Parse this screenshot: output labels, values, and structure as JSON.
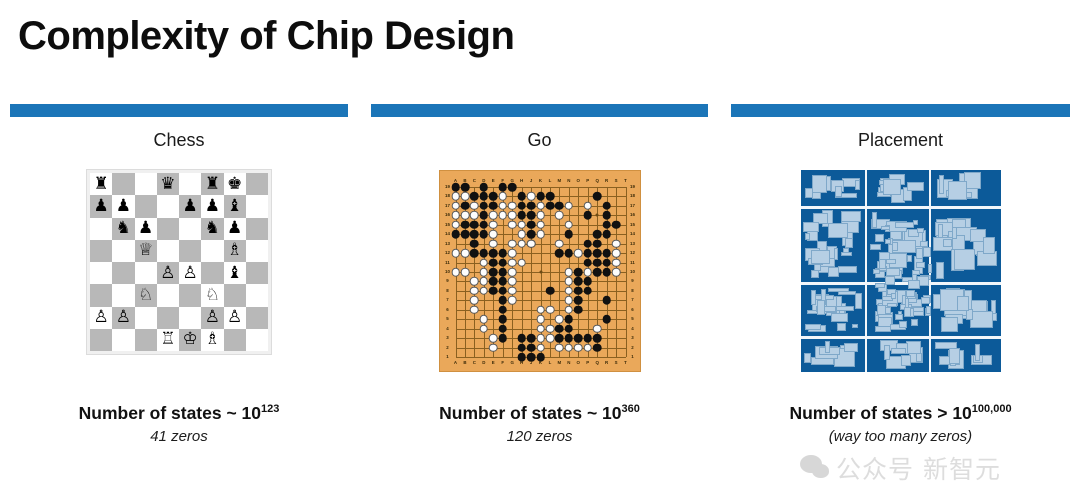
{
  "slide": {
    "title": "Complexity of Chip Design",
    "accent_color": "#1b75b8",
    "background_color": "#ffffff"
  },
  "columns": [
    {
      "id": "chess",
      "heading": "Chess",
      "figure": "chess-board",
      "caption_main_prefix": "Number of states ~ 10",
      "caption_main_exponent": "123",
      "caption_sub": "41 zeros"
    },
    {
      "id": "go",
      "heading": "Go",
      "figure": "go-board",
      "caption_main_prefix": "Number of states ~ 10",
      "caption_main_exponent": "360",
      "caption_sub": "120 zeros"
    },
    {
      "id": "placement",
      "heading": "Placement",
      "figure": "chip-placement",
      "caption_main_prefix": "Number of states > 10",
      "caption_main_exponent": "100,000",
      "caption_sub": "(way too many zeros)"
    }
  ],
  "chess": {
    "light_square_color": "#ffffff",
    "dark_square_color": "#b8b8b8",
    "ranks": [
      [
        "r",
        "",
        "",
        "q",
        "",
        "r",
        "k",
        ""
      ],
      [
        "p",
        "p",
        "",
        "",
        "p",
        "p",
        "b",
        ""
      ],
      [
        "",
        "n",
        "p",
        "",
        "",
        "n",
        "p",
        ""
      ],
      [
        "",
        "",
        "Q",
        "",
        "",
        "",
        "B",
        ""
      ],
      [
        "",
        "",
        "",
        "P",
        "P",
        "",
        "b",
        ""
      ],
      [
        "",
        "",
        "N",
        "",
        "",
        "N",
        "",
        ""
      ],
      [
        "P",
        "P",
        "",
        "",
        "",
        "P",
        "P",
        ""
      ],
      [
        "",
        "",
        "",
        "R",
        "K",
        "B",
        "",
        ""
      ]
    ],
    "glyphs": {
      "r": "♜",
      "n": "♞",
      "b": "♝",
      "q": "♛",
      "k": "♚",
      "p": "♟",
      "R": "♖",
      "N": "♘",
      "B": "♗",
      "Q": "♕",
      "K": "♔",
      "P": "♙"
    }
  },
  "go": {
    "size": 19,
    "board_color": "#eaa85a",
    "line_color": "#8a6020",
    "black_color": "#111111",
    "white_color": "#fdfdfd",
    "column_labels": [
      "A",
      "B",
      "C",
      "D",
      "E",
      "F",
      "G",
      "H",
      "J",
      "K",
      "L",
      "M",
      "N",
      "O",
      "P",
      "Q",
      "R",
      "S",
      "T"
    ],
    "row_labels": [
      "19",
      "18",
      "17",
      "16",
      "15",
      "14",
      "13",
      "12",
      "11",
      "10",
      "9",
      "8",
      "7",
      "6",
      "5",
      "4",
      "3",
      "2",
      "1"
    ],
    "black_stones": [
      [
        1,
        19
      ],
      [
        2,
        19
      ],
      [
        4,
        19
      ],
      [
        6,
        19
      ],
      [
        7,
        19
      ],
      [
        3,
        18
      ],
      [
        4,
        18
      ],
      [
        5,
        18
      ],
      [
        8,
        18
      ],
      [
        10,
        18
      ],
      [
        11,
        18
      ],
      [
        16,
        18
      ],
      [
        2,
        17
      ],
      [
        4,
        17
      ],
      [
        5,
        17
      ],
      [
        8,
        17
      ],
      [
        9,
        17
      ],
      [
        11,
        17
      ],
      [
        12,
        17
      ],
      [
        17,
        17
      ],
      [
        4,
        16
      ],
      [
        8,
        16
      ],
      [
        9,
        16
      ],
      [
        15,
        16
      ],
      [
        17,
        16
      ],
      [
        2,
        15
      ],
      [
        3,
        15
      ],
      [
        4,
        15
      ],
      [
        9,
        15
      ],
      [
        17,
        15
      ],
      [
        18,
        15
      ],
      [
        1,
        14
      ],
      [
        2,
        14
      ],
      [
        3,
        14
      ],
      [
        4,
        14
      ],
      [
        9,
        14
      ],
      [
        13,
        14
      ],
      [
        16,
        14
      ],
      [
        17,
        14
      ],
      [
        3,
        13
      ],
      [
        9,
        13
      ],
      [
        15,
        13
      ],
      [
        16,
        13
      ],
      [
        3,
        12
      ],
      [
        4,
        12
      ],
      [
        5,
        12
      ],
      [
        6,
        12
      ],
      [
        12,
        12
      ],
      [
        13,
        12
      ],
      [
        15,
        12
      ],
      [
        16,
        12
      ],
      [
        17,
        12
      ],
      [
        5,
        11
      ],
      [
        6,
        11
      ],
      [
        15,
        11
      ],
      [
        16,
        11
      ],
      [
        17,
        11
      ],
      [
        5,
        10
      ],
      [
        6,
        10
      ],
      [
        14,
        10
      ],
      [
        16,
        10
      ],
      [
        17,
        10
      ],
      [
        5,
        9
      ],
      [
        6,
        9
      ],
      [
        14,
        9
      ],
      [
        15,
        9
      ],
      [
        5,
        8
      ],
      [
        6,
        8
      ],
      [
        11,
        8
      ],
      [
        14,
        8
      ],
      [
        15,
        8
      ],
      [
        6,
        7
      ],
      [
        14,
        7
      ],
      [
        17,
        7
      ],
      [
        6,
        6
      ],
      [
        14,
        6
      ],
      [
        6,
        5
      ],
      [
        13,
        5
      ],
      [
        17,
        5
      ],
      [
        6,
        4
      ],
      [
        12,
        4
      ],
      [
        13,
        4
      ],
      [
        6,
        3
      ],
      [
        8,
        3
      ],
      [
        9,
        3
      ],
      [
        12,
        3
      ],
      [
        13,
        3
      ],
      [
        14,
        3
      ],
      [
        15,
        3
      ],
      [
        16,
        3
      ],
      [
        8,
        2
      ],
      [
        9,
        2
      ],
      [
        16,
        2
      ],
      [
        8,
        1
      ],
      [
        9,
        1
      ],
      [
        10,
        1
      ]
    ],
    "white_stones": [
      [
        1,
        18
      ],
      [
        2,
        18
      ],
      [
        6,
        18
      ],
      [
        9,
        18
      ],
      [
        1,
        17
      ],
      [
        3,
        17
      ],
      [
        6,
        17
      ],
      [
        7,
        17
      ],
      [
        10,
        17
      ],
      [
        13,
        17
      ],
      [
        15,
        17
      ],
      [
        1,
        16
      ],
      [
        2,
        16
      ],
      [
        3,
        16
      ],
      [
        5,
        16
      ],
      [
        6,
        16
      ],
      [
        7,
        16
      ],
      [
        10,
        16
      ],
      [
        12,
        16
      ],
      [
        1,
        15
      ],
      [
        5,
        15
      ],
      [
        7,
        15
      ],
      [
        8,
        15
      ],
      [
        10,
        15
      ],
      [
        13,
        15
      ],
      [
        5,
        14
      ],
      [
        8,
        14
      ],
      [
        10,
        14
      ],
      [
        5,
        13
      ],
      [
        7,
        13
      ],
      [
        8,
        13
      ],
      [
        9,
        13
      ],
      [
        12,
        13
      ],
      [
        18,
        13
      ],
      [
        1,
        12
      ],
      [
        2,
        12
      ],
      [
        7,
        12
      ],
      [
        14,
        12
      ],
      [
        18,
        12
      ],
      [
        4,
        11
      ],
      [
        7,
        11
      ],
      [
        8,
        11
      ],
      [
        18,
        11
      ],
      [
        1,
        10
      ],
      [
        2,
        10
      ],
      [
        4,
        10
      ],
      [
        7,
        10
      ],
      [
        13,
        10
      ],
      [
        15,
        10
      ],
      [
        18,
        10
      ],
      [
        3,
        9
      ],
      [
        4,
        9
      ],
      [
        7,
        9
      ],
      [
        13,
        9
      ],
      [
        3,
        8
      ],
      [
        4,
        8
      ],
      [
        7,
        8
      ],
      [
        13,
        8
      ],
      [
        3,
        7
      ],
      [
        7,
        7
      ],
      [
        13,
        7
      ],
      [
        3,
        6
      ],
      [
        10,
        6
      ],
      [
        11,
        6
      ],
      [
        13,
        6
      ],
      [
        4,
        5
      ],
      [
        10,
        5
      ],
      [
        12,
        5
      ],
      [
        4,
        4
      ],
      [
        10,
        4
      ],
      [
        11,
        4
      ],
      [
        16,
        4
      ],
      [
        5,
        3
      ],
      [
        10,
        3
      ],
      [
        11,
        3
      ],
      [
        5,
        2
      ],
      [
        10,
        2
      ],
      [
        12,
        2
      ],
      [
        13,
        2
      ],
      [
        14,
        2
      ],
      [
        15,
        2
      ]
    ]
  },
  "placement": {
    "background_color": "#0c5a99",
    "block_color": "#b6cfe4",
    "channel_color": "#f2f6fa",
    "description": "chip floorplan with macro blocks"
  },
  "watermark": {
    "text": "公众号 新智元",
    "logo": "wechat-icon"
  }
}
